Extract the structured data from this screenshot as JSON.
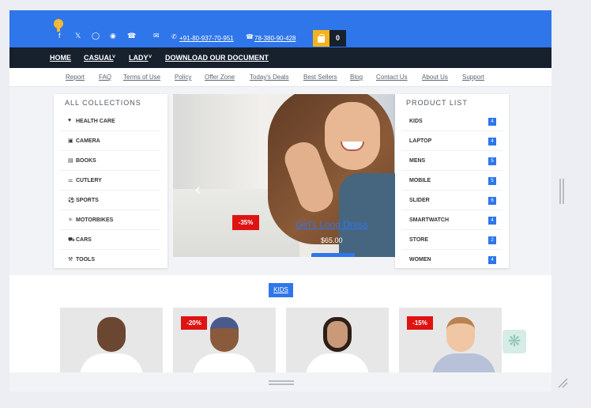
{
  "header": {
    "social_icons": [
      "facebook-icon",
      "twitter-icon",
      "instagram-icon",
      "pinterest-icon",
      "whatsapp-icon"
    ],
    "phone": "+91-80-937-70-951",
    "whatsapp": "78-380-90-428",
    "cart_count": "0"
  },
  "main_nav": [
    "HOME",
    "CASUAL",
    "LADY",
    "DOWNLOAD OUR DOCUMENT"
  ],
  "sub_nav": [
    "Report",
    "FAQ",
    "Terms of Use",
    "Policy",
    "Offer Zone",
    "Today's Deals",
    "Best Sellers",
    "Blog",
    "Contact Us",
    "About Us",
    "Support"
  ],
  "collections": {
    "title": "ALL COLLECTIONS",
    "items": [
      {
        "label": "HEALTH CARE",
        "icon": "heartbeat-icon"
      },
      {
        "label": "CAMERA",
        "icon": "camera-icon"
      },
      {
        "label": "BOOKS",
        "icon": "book-icon"
      },
      {
        "label": "CUTLERY",
        "icon": "cutlery-icon"
      },
      {
        "label": "SPORTS",
        "icon": "ball-icon"
      },
      {
        "label": "MOTORBIKES",
        "icon": "motorbike-icon"
      },
      {
        "label": "CARS",
        "icon": "car-icon"
      },
      {
        "label": "TOOLS",
        "icon": "wrench-icon"
      }
    ]
  },
  "hero": {
    "discount": "-35%",
    "title": "Girl's Long Dress",
    "price": "$65.00"
  },
  "products": {
    "title": "PRODUCT LIST",
    "items": [
      {
        "label": "KIDS",
        "count": "4"
      },
      {
        "label": "LAPTOP",
        "count": "4"
      },
      {
        "label": "MENS",
        "count": "5"
      },
      {
        "label": "MOBILE",
        "count": "5"
      },
      {
        "label": "SLIDER",
        "count": "6"
      },
      {
        "label": "SMARTWATCH",
        "count": "4"
      },
      {
        "label": "STORE",
        "count": "2"
      },
      {
        "label": "WOMEN",
        "count": "4"
      }
    ]
  },
  "kids_section": {
    "tab": "KIDS",
    "discounts": [
      "-20%",
      "-15%"
    ]
  },
  "colors": {
    "brand": "#2f76ea",
    "dark": "#17202d",
    "sale": "#e01313",
    "cart": "#f4b21d"
  }
}
